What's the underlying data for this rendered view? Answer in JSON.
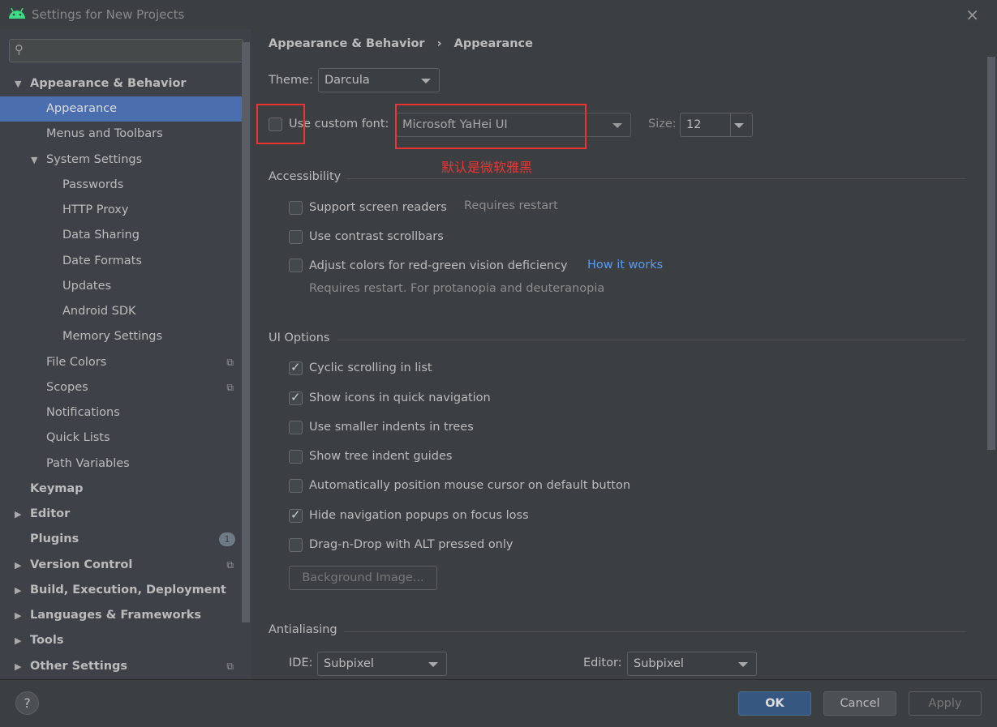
{
  "window": {
    "title": "Settings for New Projects",
    "close_icon": "×"
  },
  "sidebar": {
    "search_placeholder": "",
    "items": [
      {
        "label": "Appearance & Behavior",
        "level": 0,
        "bold": true,
        "arrow": "▼"
      },
      {
        "label": "Appearance",
        "level": 1,
        "selected": true
      },
      {
        "label": "Menus and Toolbars",
        "level": 1
      },
      {
        "label": "System Settings",
        "level": 1,
        "arrow": "▼"
      },
      {
        "label": "Passwords",
        "level": 2
      },
      {
        "label": "HTTP Proxy",
        "level": 2
      },
      {
        "label": "Data Sharing",
        "level": 2
      },
      {
        "label": "Date Formats",
        "level": 2
      },
      {
        "label": "Updates",
        "level": 2
      },
      {
        "label": "Android SDK",
        "level": 2
      },
      {
        "label": "Memory Settings",
        "level": 2
      },
      {
        "label": "File Colors",
        "level": 1,
        "icon": "copy-icon"
      },
      {
        "label": "Scopes",
        "level": 1,
        "icon": "copy-icon"
      },
      {
        "label": "Notifications",
        "level": 1
      },
      {
        "label": "Quick Lists",
        "level": 1
      },
      {
        "label": "Path Variables",
        "level": 1
      },
      {
        "label": "Keymap",
        "level": 0,
        "bold": true
      },
      {
        "label": "Editor",
        "level": 0,
        "bold": true,
        "arrow": "▶"
      },
      {
        "label": "Plugins",
        "level": 0,
        "bold": true,
        "badge": "1"
      },
      {
        "label": "Version Control",
        "level": 0,
        "bold": true,
        "arrow": "▶",
        "icon": "copy-icon"
      },
      {
        "label": "Build, Execution, Deployment",
        "level": 0,
        "bold": true,
        "arrow": "▶"
      },
      {
        "label": "Languages & Frameworks",
        "level": 0,
        "bold": true,
        "arrow": "▶"
      },
      {
        "label": "Tools",
        "level": 0,
        "bold": true,
        "arrow": "▶"
      },
      {
        "label": "Other Settings",
        "level": 0,
        "bold": true,
        "arrow": "▶",
        "icon": "copy-icon"
      }
    ]
  },
  "main": {
    "breadcrumb": [
      "Appearance & Behavior",
      "Appearance"
    ],
    "theme_label": "Theme:",
    "theme_value": "Darcula",
    "custom_font_label": "Use custom font:",
    "custom_font_checked": false,
    "font_value": "Microsoft YaHei UI",
    "size_label": "Size:",
    "size_value": "12",
    "annotation": "默认是微软雅黑",
    "accessibility": {
      "title": "Accessibility",
      "screen_readers": "Support screen readers",
      "requires_restart": "Requires restart",
      "contrast": "Use contrast scrollbars",
      "colors": "Adjust colors for red-green vision deficiency",
      "how_it_works": "How it works",
      "colors_note": "Requires restart. For protanopia and deuteranopia"
    },
    "ui_options": {
      "title": "UI Options",
      "items": [
        {
          "label": "Cyclic scrolling in list",
          "checked": true
        },
        {
          "label": "Show icons in quick navigation",
          "checked": true
        },
        {
          "label": "Use smaller indents in trees",
          "checked": false
        },
        {
          "label": "Show tree indent guides",
          "checked": false
        },
        {
          "label": "Automatically position mouse cursor on default button",
          "checked": false
        },
        {
          "label": "Hide navigation popups on focus loss",
          "checked": true
        },
        {
          "label": "Drag-n-Drop with ALT pressed only",
          "checked": false
        }
      ],
      "background_button": "Background Image..."
    },
    "antialiasing": {
      "title": "Antialiasing",
      "ide_label": "IDE:",
      "ide_value": "Subpixel",
      "editor_label": "Editor:",
      "editor_value": "Subpixel"
    }
  },
  "footer": {
    "help": "?",
    "ok": "OK",
    "cancel": "Cancel",
    "apply": "Apply"
  },
  "colors": {
    "selection": "#4b6eaf",
    "link": "#589df6",
    "annotation": "#ee3333",
    "ok_button": "#365880"
  }
}
